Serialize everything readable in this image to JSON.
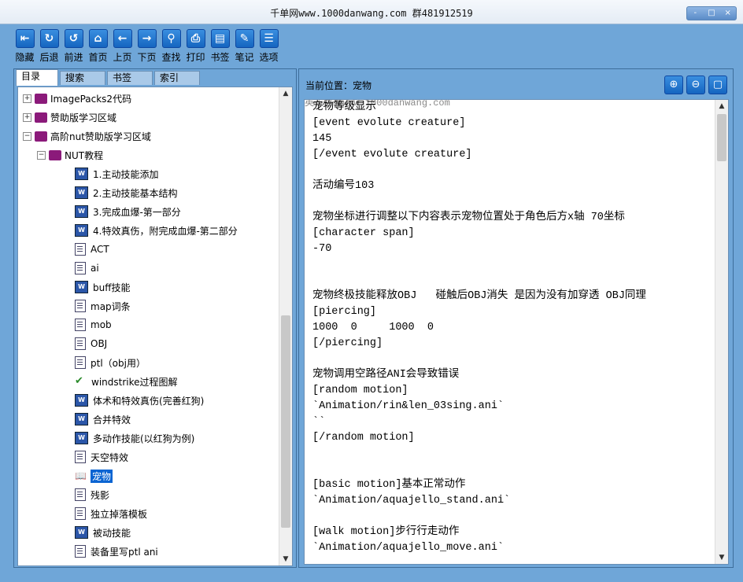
{
  "window": {
    "title": "千单网www.1000danwang.com 群481912519",
    "controls": [
      "-",
      "□",
      "×"
    ]
  },
  "toolbar": [
    {
      "label": "隐藏",
      "icon": "hide-icon",
      "glyph": "⇤"
    },
    {
      "label": "后退",
      "icon": "back-circle-icon",
      "glyph": "↻"
    },
    {
      "label": "前进",
      "icon": "forward-circle-icon",
      "glyph": "↺"
    },
    {
      "label": "首页",
      "icon": "home-icon",
      "glyph": "⌂"
    },
    {
      "label": "上页",
      "icon": "prev-page-icon",
      "glyph": "←"
    },
    {
      "label": "下页",
      "icon": "next-page-icon",
      "glyph": "→"
    },
    {
      "label": "查找",
      "icon": "search-icon",
      "glyph": "⚲"
    },
    {
      "label": "打印",
      "icon": "print-icon",
      "glyph": "⎙"
    },
    {
      "label": "书签",
      "icon": "bookmark-icon",
      "glyph": "▤"
    },
    {
      "label": "笔记",
      "icon": "note-icon",
      "glyph": "✎"
    },
    {
      "label": "选项",
      "icon": "options-icon",
      "glyph": "☰"
    }
  ],
  "tabs": [
    "目录",
    "搜索",
    "书签",
    "索引"
  ],
  "active_tab": "目录",
  "tree": [
    {
      "label": "ImagePacks2代码",
      "icon": "book-icon",
      "expander": "+",
      "level": 0
    },
    {
      "label": "赞助版学习区域",
      "icon": "book-icon",
      "expander": "+",
      "level": 0
    },
    {
      "label": "高阶nut赞助版学习区域",
      "icon": "book-icon",
      "expander": "−",
      "level": 0
    },
    {
      "label": "NUT教程",
      "icon": "book-icon",
      "expander": "−",
      "level": 1
    },
    {
      "label": "1.主动技能添加",
      "icon": "word-icon",
      "level": 2
    },
    {
      "label": "2.主动技能基本结构",
      "icon": "word-icon",
      "level": 2
    },
    {
      "label": "3.完成血爆-第一部分",
      "icon": "word-icon",
      "level": 2
    },
    {
      "label": "4.特效真伤，附完成血爆-第二部分",
      "icon": "word-icon",
      "level": 2
    },
    {
      "label": "ACT",
      "icon": "doc-icon",
      "level": 2
    },
    {
      "label": "ai",
      "icon": "doc-icon",
      "level": 2
    },
    {
      "label": "buff技能",
      "icon": "word-icon",
      "level": 2
    },
    {
      "label": "map词条",
      "icon": "doc-icon",
      "level": 2
    },
    {
      "label": "mob",
      "icon": "doc-icon",
      "level": 2
    },
    {
      "label": "OBJ",
      "icon": "doc-icon",
      "level": 2
    },
    {
      "label": "ptl（obj用）",
      "icon": "doc-icon",
      "level": 2
    },
    {
      "label": "windstrike过程图解",
      "icon": "check-icon",
      "level": 2
    },
    {
      "label": "体术和特效真伤(完善红狗)",
      "icon": "word-icon",
      "level": 2
    },
    {
      "label": "合并特效",
      "icon": "word-icon",
      "level": 2
    },
    {
      "label": "多动作技能(以红狗为例)",
      "icon": "word-icon",
      "level": 2
    },
    {
      "label": "天空特效",
      "icon": "doc-icon",
      "level": 2
    },
    {
      "label": "宠物",
      "icon": "open-book-icon",
      "level": 2,
      "selected": true
    },
    {
      "label": "残影",
      "icon": "doc-icon",
      "level": 2
    },
    {
      "label": "独立掉落模板",
      "icon": "doc-icon",
      "level": 2
    },
    {
      "label": "被动技能",
      "icon": "word-icon",
      "level": 2
    },
    {
      "label": "装备里写ptl ani",
      "icon": "doc-icon",
      "level": 2
    }
  ],
  "location": {
    "label": "当前位置：",
    "value": "宠物"
  },
  "zoom_buttons": [
    {
      "name": "zoom-in-icon",
      "glyph": "⊕"
    },
    {
      "name": "zoom-out-icon",
      "glyph": "⊖"
    },
    {
      "name": "fullscreen-icon",
      "glyph": "▢"
    }
  ],
  "watermark": "英花宫微www.1000danwang.com",
  "content_lines": [
    "宠物等级显示",
    "[event evolute creature]",
    "145",
    "[/event evolute creature]",
    "",
    "活动编号103",
    "",
    "宠物坐标进行调整以下内容表示宠物位置处于角色后方x轴 70坐标",
    "[character span]",
    "-70",
    "",
    "",
    "宠物终极技能释放OBJ   碰触后OBJ消失 是因为没有加穿透 OBJ同理",
    "[piercing]",
    "1000  0     1000  0",
    "[/piercing]",
    "",
    "宠物调用空路径ANI会导致错误",
    "[random motion]",
    "`Animation/rin&len_03sing.ani`",
    "``",
    "[/random motion]",
    "",
    "",
    "[basic motion]基本正常动作",
    "`Animation/aquajello_stand.ani`",
    "",
    "[walk motion]步行行走动作",
    "`Animation/aquajello_move.ani`"
  ]
}
